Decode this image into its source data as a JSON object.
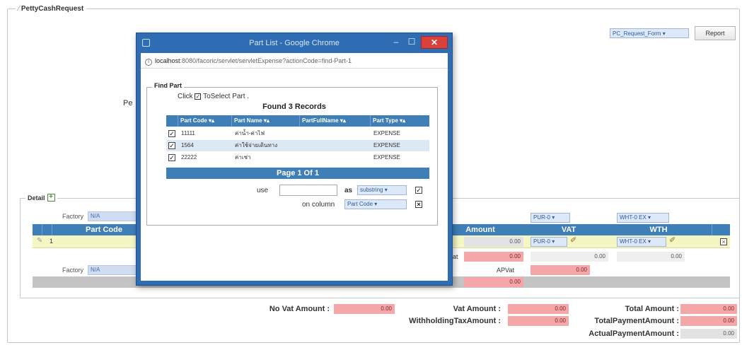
{
  "form": {
    "title": "PettyCashRequest",
    "report_select": "PC_Request_Form",
    "report_button": "Report",
    "partial_label": "Pe"
  },
  "popup": {
    "window_title": "Part List - Google Chrome",
    "url_host": "localhost",
    "url_rest": ":8080/facoric/servlet/servletExpense?actionCode=find-Part-1",
    "find_legend": "Find Part",
    "click_prefix": "Click",
    "click_suffix": "ToSelect Part .",
    "found_text": "Found 3 Records",
    "columns": [
      "Part Code",
      "Part Name",
      "PartFullName",
      "Part Type"
    ],
    "rows": [
      {
        "code": "11111",
        "name": "ค่าน้ำ-ค่าไฟ",
        "full": "",
        "type": "EXPENSE"
      },
      {
        "code": "1564",
        "name": "ค่าใช้จ่ายเดินทาง",
        "full": "",
        "type": "EXPENSE"
      },
      {
        "code": "22222",
        "name": "ค่าเช่า",
        "full": "",
        "type": "EXPENSE"
      }
    ],
    "pager": "Page  1  Of  1",
    "use_label": "use",
    "as_label": "as",
    "as_select": "substring",
    "on_column_label": "on column",
    "column_select": "Part Code",
    "checkmark": "✓"
  },
  "detail": {
    "legend": "Detail",
    "factory_label": "Factory",
    "factory_value": "N/A",
    "headers": {
      "part_code": "Part Code",
      "amount": "Amount",
      "vat": "VAT",
      "wth": "WTH"
    },
    "vat_top_select": "PUR-0",
    "wth_top_select": "WHT-0 EX",
    "row": {
      "num": "1",
      "amount": "0.00",
      "vat_select": "PUR-0",
      "vat_value": "0.00",
      "wth_select": "WHT-0 EX",
      "wth_value": "0.00"
    },
    "vat_partial_label": "at",
    "vat_amount": "0.00",
    "vat_amount2": "0.00",
    "apvat_label": "APVat",
    "apvat_value": "0.00",
    "gray_amount": "0.00"
  },
  "summary": {
    "novat_label": "No Vat Amount :",
    "novat_value": "0.00",
    "vat_label": "Vat Amount :",
    "vat_value": "0.00",
    "total_label": "Total Amount :",
    "total_value": "0.00",
    "wht_label": "WithholdingTaxAmount :",
    "wht_value": "0.00",
    "totalpay_label": "TotalPaymentAmount :",
    "totalpay_value": "0.00",
    "actualpay_label": "ActualPaymentAmount :",
    "actualpay_value": "0.00"
  }
}
